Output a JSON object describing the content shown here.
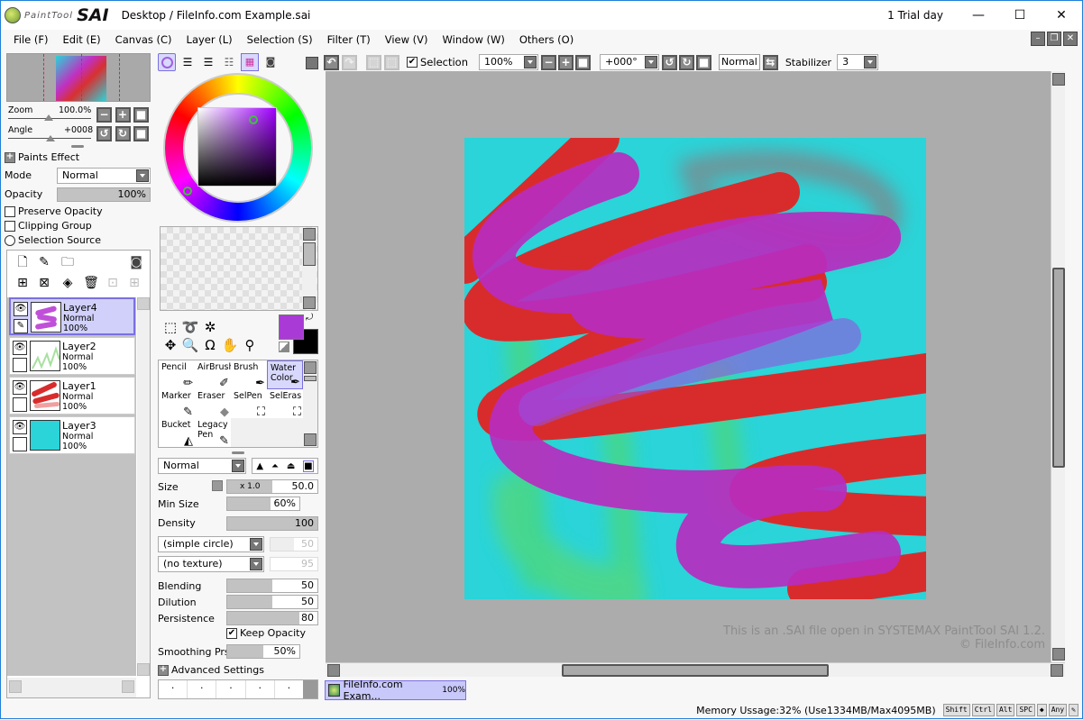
{
  "window": {
    "app_name_small": "PaintTool",
    "app_name_big": "SAI",
    "title": "Desktop / FileInfo.com Example.sai",
    "trial": "1 Trial day",
    "minimize": "—",
    "maximize": "☐",
    "close": "✕"
  },
  "menu": [
    "File (F)",
    "Edit (E)",
    "Canvas (C)",
    "Layer (L)",
    "Selection (S)",
    "Filter (T)",
    "View (V)",
    "Window (W)",
    "Others (O)"
  ],
  "navigator": {
    "zoom_label": "Zoom",
    "zoom_value": "100.0%",
    "angle_label": "Angle",
    "angle_value": "+0008"
  },
  "layer_props": {
    "paints_effect": "Paints Effect",
    "mode_label": "Mode",
    "mode_value": "Normal",
    "opacity_label": "Opacity",
    "opacity_value": "100%",
    "opacity_fraction": 1.0,
    "preserve_opacity": "Preserve Opacity",
    "clipping_group": "Clipping Group",
    "selection_source": "Selection Source"
  },
  "layers": [
    {
      "name": "Layer4",
      "mode": "Normal",
      "opacity": "100%",
      "selected": true,
      "thumb": "purple-scribble"
    },
    {
      "name": "Layer2",
      "mode": "Normal",
      "opacity": "100%",
      "selected": false,
      "thumb": "green-zigzag"
    },
    {
      "name": "Layer1",
      "mode": "Normal",
      "opacity": "100%",
      "selected": false,
      "thumb": "red-scribble"
    },
    {
      "name": "Layer3",
      "mode": "Normal",
      "opacity": "100%",
      "selected": false,
      "thumb": "cyan-fill"
    }
  ],
  "colors": {
    "primary": "#a93ad6",
    "secondary": "#000000",
    "canvas_bg": "#2ad4d8",
    "red_stroke": "#d82c2c",
    "purple_stroke": "#b82cc0",
    "accent": "#7a70e0"
  },
  "tools": [
    {
      "label": "Pencil",
      "icon": "pencil-icon",
      "glyph": "✏"
    },
    {
      "label": "AirBrush",
      "icon": "airbrush-icon",
      "glyph": "✎"
    },
    {
      "label": "Brush",
      "icon": "brush-icon",
      "glyph": "🖌"
    },
    {
      "label": "Water Color",
      "icon": "watercolor-icon",
      "glyph": "💧",
      "selected": true
    },
    {
      "label": "Marker",
      "icon": "marker-icon",
      "glyph": "✏"
    },
    {
      "label": "Eraser",
      "icon": "eraser-icon",
      "glyph": "◆"
    },
    {
      "label": "SelPen",
      "icon": "selpen-icon",
      "glyph": "✎"
    },
    {
      "label": "SelEras",
      "icon": "seleras-icon",
      "glyph": "◈"
    },
    {
      "label": "Bucket",
      "icon": "bucket-icon",
      "glyph": "◣"
    },
    {
      "label": "Legacy Pen",
      "icon": "legacy-pen-icon",
      "glyph": "✎"
    }
  ],
  "brush": {
    "blend_mode": "Normal",
    "size_label": "Size",
    "size_multiplier": "x 1.0",
    "size_value": "50.0",
    "size_fraction": 0.5,
    "min_size_label": "Min Size",
    "min_size_value": "60%",
    "min_size_fraction": 0.6,
    "density_label": "Density",
    "density_value": "100",
    "density_fraction": 1.0,
    "shape": "(simple circle)",
    "shape_value": "50",
    "texture": "(no texture)",
    "texture_value": "95",
    "blending_label": "Blending",
    "blending_value": "50",
    "blending_fraction": 0.5,
    "dilution_label": "Dilution",
    "dilution_value": "50",
    "dilution_fraction": 0.5,
    "persistence_label": "Persistence",
    "persistence_value": "80",
    "persistence_fraction": 0.8,
    "keep_opacity": "Keep Opacity",
    "smoothing_label": "Smoothing Prs",
    "smoothing_value": "50%",
    "smoothing_fraction": 0.5,
    "advanced": "Advanced Settings"
  },
  "toolbar": {
    "selection_label": "Selection",
    "zoom_value": "100%",
    "angle_value": "+000°",
    "blend_value": "Normal",
    "stabilizer_label": "Stabilizer",
    "stabilizer_value": "3"
  },
  "canvas": {
    "watermark_line1": "This is an .SAI file open in SYSTEMAX PaintTool SAI 1.2.",
    "watermark_line2": "© FileInfo.com"
  },
  "doc_tab": {
    "name": "FileInfo.com Exam...",
    "zoom": "100%"
  },
  "status": {
    "memory": "Memory Ussage:32% (Use1334MB/Max4095MB)",
    "keys": [
      "Shift",
      "Ctrl",
      "Alt",
      "SPC",
      "◆",
      "Any",
      "✎"
    ]
  }
}
